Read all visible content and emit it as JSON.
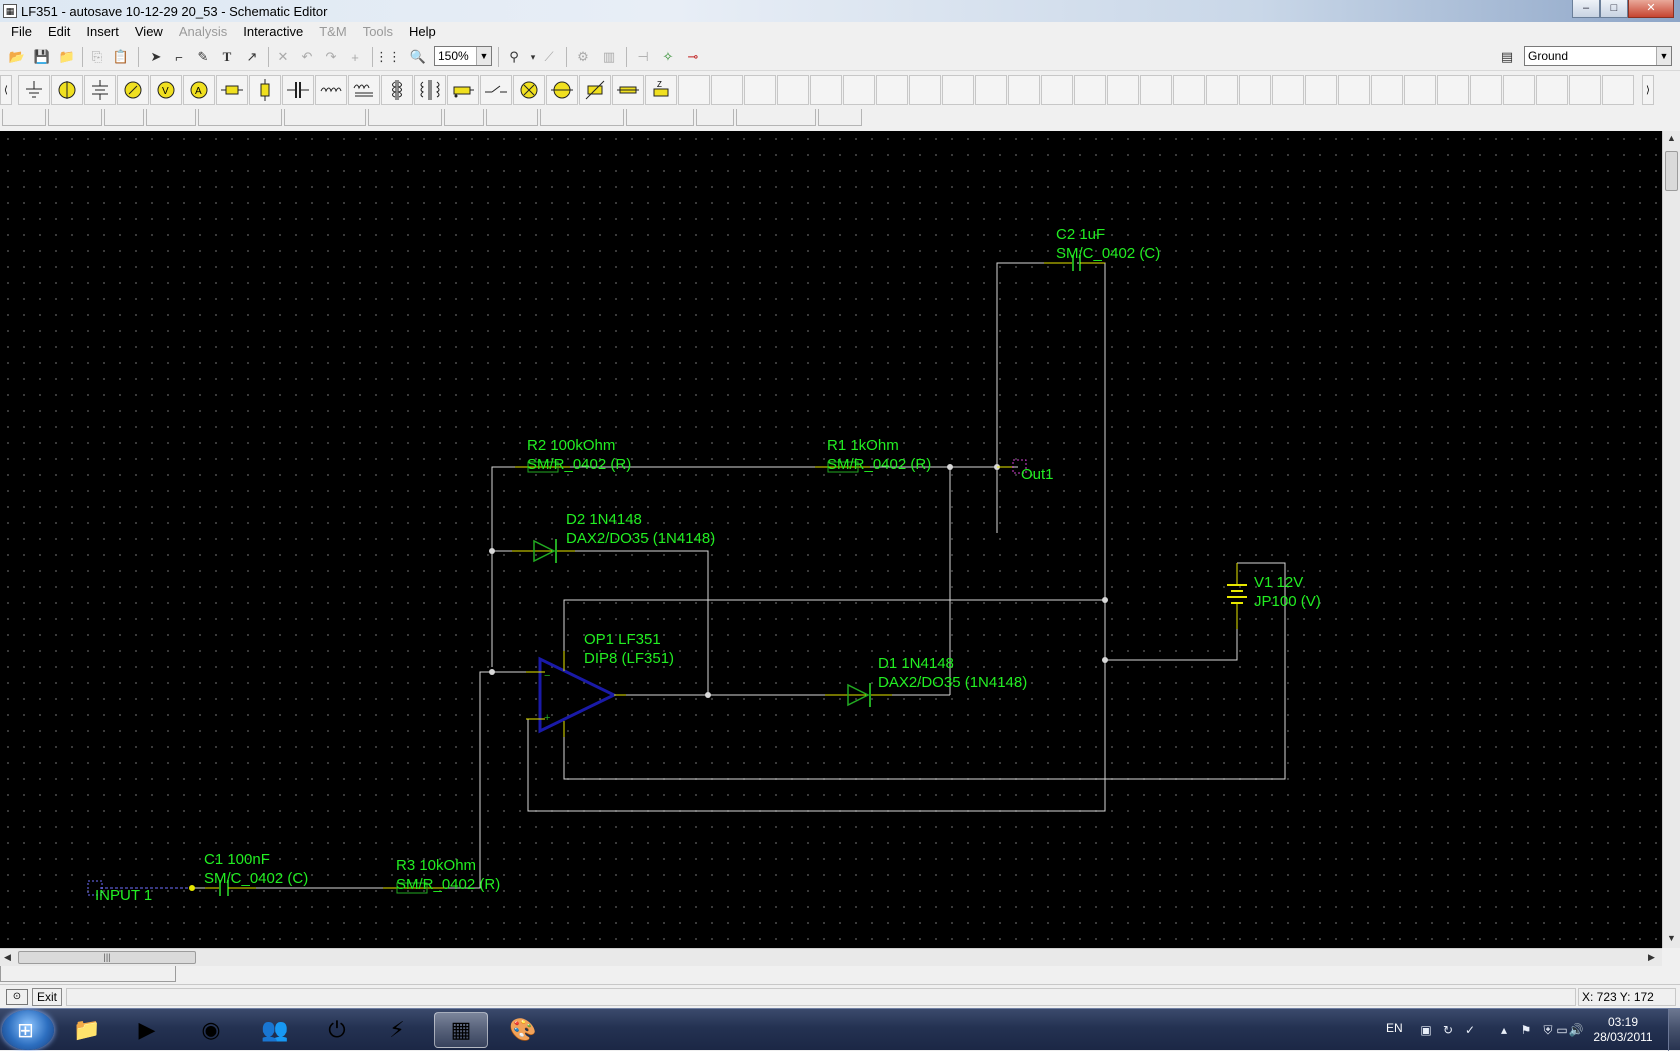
{
  "window": {
    "title": "LF351 - autosave 10-12-29 20_53 - Schematic Editor",
    "minimize": "–",
    "maximize": "□",
    "close": "✕"
  },
  "menu": [
    {
      "label": "File",
      "enabled": true
    },
    {
      "label": "Edit",
      "enabled": true
    },
    {
      "label": "Insert",
      "enabled": true
    },
    {
      "label": "View",
      "enabled": true
    },
    {
      "label": "Analysis",
      "enabled": false
    },
    {
      "label": "Interactive",
      "enabled": true
    },
    {
      "label": "T&M",
      "enabled": false
    },
    {
      "label": "Tools",
      "enabled": false
    },
    {
      "label": "Help",
      "enabled": true
    }
  ],
  "toolbar": {
    "zoom_value": "150%",
    "net_select": "Ground"
  },
  "schematic": {
    "labels": {
      "c2_name": "C2 1uF",
      "c2_pkg": "SM/C_0402 (C)",
      "r2_name": "R2 100kOhm",
      "r2_pkg": "SM/R_0402 (R)",
      "r1_name": "R1 1kOhm",
      "r1_pkg": "SM/R_0402 (R)",
      "out1": "Out1",
      "d2_name": "D2 1N4148",
      "d2_pkg": "DAX2/DO35 (1N4148)",
      "v1_name": "V1 12V",
      "v1_pkg": "JP100 (V)",
      "op1_name": "OP1 LF351",
      "op1_pkg": "DIP8 (LF351)",
      "d1_name": "D1 1N4148",
      "d1_pkg": "DAX2/DO35 (1N4148)",
      "c1_name": "C1 100nF",
      "c1_pkg": "SM/C_0402 (C)",
      "r3_name": "R3 10kOhm",
      "r3_pkg": "SM/R_0402 (R)",
      "input1": "INPUT 1"
    },
    "colors": {
      "background": "#000000",
      "wire": "#d8d8d8",
      "label": "#22ee22",
      "component": "#22aa22",
      "opamp": "#1a1aa8",
      "pin": "#e8e800",
      "port": "#d040d0"
    }
  },
  "status": {
    "exit_label": "Exit",
    "coords": "X: 723  Y: 172"
  },
  "taskbar": {
    "language": "EN",
    "time": "03:19",
    "date": "28/03/2011"
  }
}
